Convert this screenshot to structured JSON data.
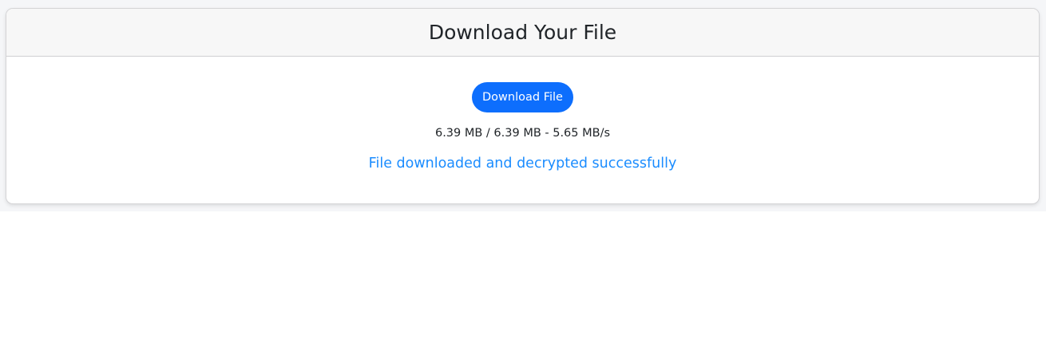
{
  "header": {
    "title": "Download Your File"
  },
  "main": {
    "download_button_label": "Download File",
    "progress_text": "6.39 MB / 6.39 MB - 5.65 MB/s",
    "status_message": "File downloaded and decrypted successfully"
  },
  "colors": {
    "accent": "#0d6efd",
    "success_text": "#1a8cff"
  }
}
